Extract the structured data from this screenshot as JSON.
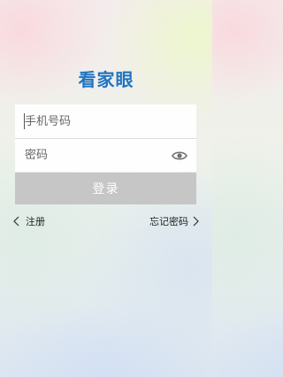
{
  "app": {
    "logo_text": "看家眼"
  },
  "login_form": {
    "phone_placeholder": "手机号码",
    "password_placeholder": "密码",
    "show_password_icon": "eye-icon",
    "login_label": "登录",
    "login_button_color": "#c6c6c6",
    "brand_color": "#1f74c2"
  },
  "links": {
    "register_label": "注册",
    "register_icon": "chevron-left-icon",
    "forgot_password_label": "忘记密码",
    "forgot_password_icon": "chevron-right-icon"
  }
}
